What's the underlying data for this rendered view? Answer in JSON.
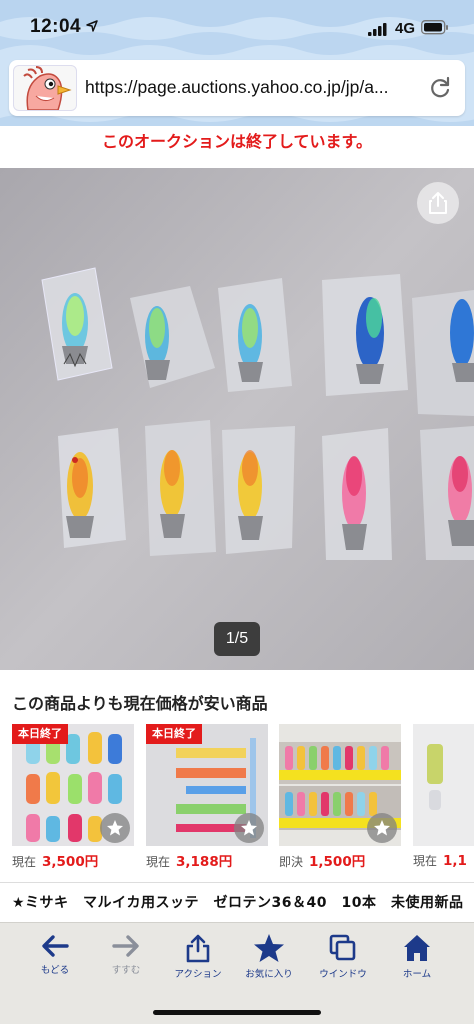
{
  "status_bar": {
    "time": "12:04",
    "network": "4G",
    "icons": [
      "location-arrow-icon",
      "signal-bars-icon",
      "battery-icon"
    ]
  },
  "browser": {
    "url": "https://page.auctions.yahoo.co.jp/jp/a...",
    "site_icon": "mascot-bird-icon",
    "reload_icon": "reload-icon"
  },
  "auction": {
    "ended_notice": "このオークションは終了しています。"
  },
  "gallery": {
    "counter": "1/5",
    "share_icon": "share-icon"
  },
  "cheaper_items": {
    "title": "この商品よりも現在価格が安い商品",
    "cards": [
      {
        "badge": "本日終了",
        "price_label": "現在",
        "price": "3,500円"
      },
      {
        "badge": "本日終了",
        "price_label": "現在",
        "price": "3,188円"
      },
      {
        "badge": "",
        "price_label": "即決",
        "price": "1,500円"
      },
      {
        "badge": "",
        "price_label": "現在",
        "price": "1,1"
      }
    ]
  },
  "item": {
    "title": "★ミサキ　マルイカ用スッテ　ゼロテン36＆40　10本　未使用新品"
  },
  "toolbar": {
    "back": "もどる",
    "forward": "すすむ",
    "action": "アクション",
    "favorites": "お気に入り",
    "window": "ウインドウ",
    "home": "ホーム"
  },
  "colors": {
    "accent_red": "#e31b1b",
    "toolbar_blue": "#1d3a8a",
    "header_blue": "#cfe3f6"
  }
}
